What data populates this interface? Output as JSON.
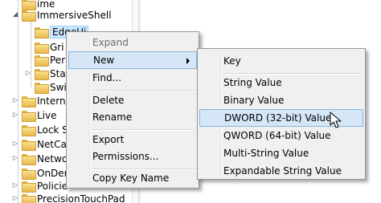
{
  "tree": {
    "nodes": [
      {
        "label": "ime",
        "expander": ""
      },
      {
        "label": "ImmersiveShell",
        "expander": "◢"
      },
      {
        "label": "EdgeUi",
        "expander": ""
      },
      {
        "label": "Gri",
        "expander": ""
      },
      {
        "label": "Per",
        "expander": ""
      },
      {
        "label": "Sta",
        "expander": "▷"
      },
      {
        "label": "Swi",
        "expander": ""
      },
      {
        "label": "Interne",
        "expander": "▷"
      },
      {
        "label": "Live",
        "expander": "▷"
      },
      {
        "label": "Lock Sc",
        "expander": ""
      },
      {
        "label": "NetCac",
        "expander": "▷"
      },
      {
        "label": "Netwo",
        "expander": "▷"
      },
      {
        "label": "OnDem",
        "expander": ""
      },
      {
        "label": "Policie",
        "expander": "▷"
      },
      {
        "label": "PrecisionTouchPad",
        "expander": "▷"
      }
    ]
  },
  "context_menu": {
    "items": [
      {
        "label": "Expand",
        "disabled": true
      },
      {
        "label": "New",
        "hot": true,
        "submenu": true
      },
      {
        "label": "Find..."
      },
      {
        "label": "Delete"
      },
      {
        "label": "Rename"
      },
      {
        "label": "Export"
      },
      {
        "label": "Permissions..."
      },
      {
        "label": "Copy Key Name"
      }
    ]
  },
  "new_submenu": {
    "items": [
      {
        "label": "Key"
      },
      {
        "label": "String Value"
      },
      {
        "label": "Binary Value"
      },
      {
        "label": "DWORD (32-bit) Value",
        "hot": true
      },
      {
        "label": "QWORD (64-bit) Value"
      },
      {
        "label": "Multi-String Value"
      },
      {
        "label": "Expandable String Value"
      }
    ]
  },
  "colors": {
    "folder": "#e8b84a",
    "menu_bg": "#f0f0f0",
    "hover_bg": "#d5e6f7",
    "hover_border": "#88b6e0"
  }
}
